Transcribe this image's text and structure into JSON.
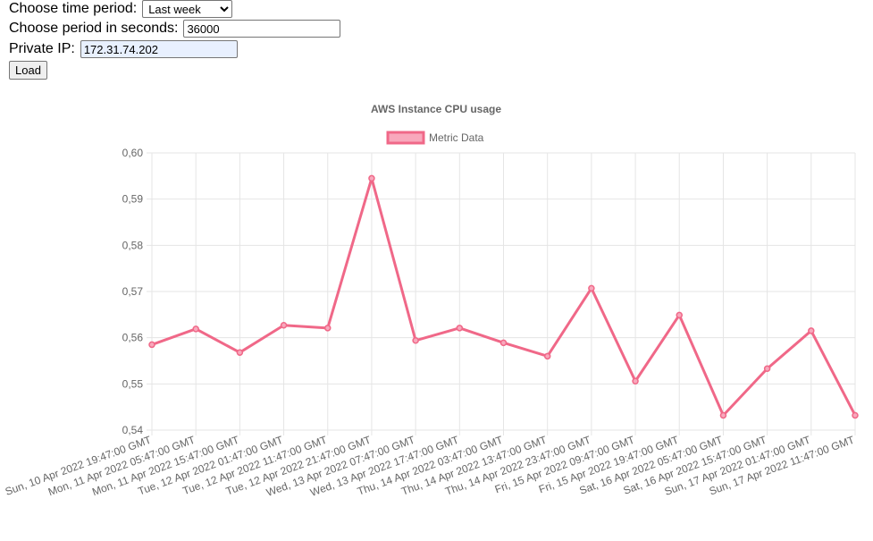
{
  "form": {
    "period_label": "Choose time period:",
    "period_selected": "Last week",
    "seconds_label": "Choose period in seconds:",
    "seconds_value": "36000",
    "ip_label": "Private IP:",
    "ip_value": "172.31.74.202",
    "load_label": "Load"
  },
  "chart_data": {
    "type": "line",
    "title": "AWS Instance CPU usage",
    "xlabel": "",
    "ylabel": "",
    "ylim": [
      0.54,
      0.6
    ],
    "yticks": [
      "0,60",
      "0,59",
      "0,58",
      "0,57",
      "0,56",
      "0,55",
      "0,54"
    ],
    "legend_position": "top",
    "grid": true,
    "categories": [
      "Sun, 10 Apr 2022 19:47:00 GMT",
      "Mon, 11 Apr 2022 05:47:00 GMT",
      "Mon, 11 Apr 2022 15:47:00 GMT",
      "Tue, 12 Apr 2022 01:47:00 GMT",
      "Tue, 12 Apr 2022 11:47:00 GMT",
      "Tue, 12 Apr 2022 21:47:00 GMT",
      "Wed, 13 Apr 2022 07:47:00 GMT",
      "Wed, 13 Apr 2022 17:47:00 GMT",
      "Thu, 14 Apr 2022 03:47:00 GMT",
      "Thu, 14 Apr 2022 13:47:00 GMT",
      "Thu, 14 Apr 2022 23:47:00 GMT",
      "Fri, 15 Apr 2022 09:47:00 GMT",
      "Fri, 15 Apr 2022 19:47:00 GMT",
      "Sat, 16 Apr 2022 05:47:00 GMT",
      "Sat, 16 Apr 2022 15:47:00 GMT",
      "Sun, 17 Apr 2022 01:47:00 GMT",
      "Sun, 17 Apr 2022 11:47:00 GMT"
    ],
    "series": [
      {
        "name": "Metric Data",
        "color": "#f06888",
        "fill": "#f8a8bc",
        "values": [
          0.5585,
          0.5619,
          0.5568,
          0.5627,
          0.5621,
          0.5945,
          0.5594,
          0.5621,
          0.5589,
          0.556,
          0.5707,
          0.5506,
          0.5649,
          0.5432,
          0.5533,
          0.5615,
          0.5432
        ]
      }
    ]
  }
}
